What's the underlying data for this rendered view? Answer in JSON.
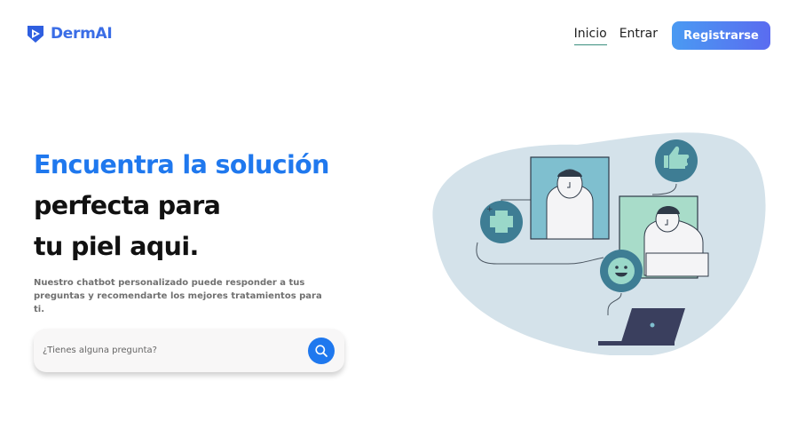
{
  "brand": {
    "name": "DermAI",
    "color": "#3a6de6"
  },
  "nav": {
    "items": [
      {
        "label": "Inicio",
        "active": true
      },
      {
        "label": "Entrar",
        "active": false
      }
    ],
    "register_label": "Registrarse"
  },
  "hero": {
    "title_accent": "Encuentra la solución",
    "title_line2": "perfecta para",
    "title_line3": "tu piel aqui.",
    "description": "Nuestro chatbot personalizado puede responder a tus preguntas y recomendarte los mejores tratamientos para ti."
  },
  "search": {
    "placeholder": "¿Tienes alguna pregunta?",
    "button_icon": "search-icon"
  },
  "colors": {
    "accent": "#1f78ee",
    "button_gradient_start": "#4a9af2",
    "button_gradient_end": "#5a6cf0",
    "illustration_bg": "#d4e2ea",
    "illustration_teal": "#3e7d94"
  }
}
